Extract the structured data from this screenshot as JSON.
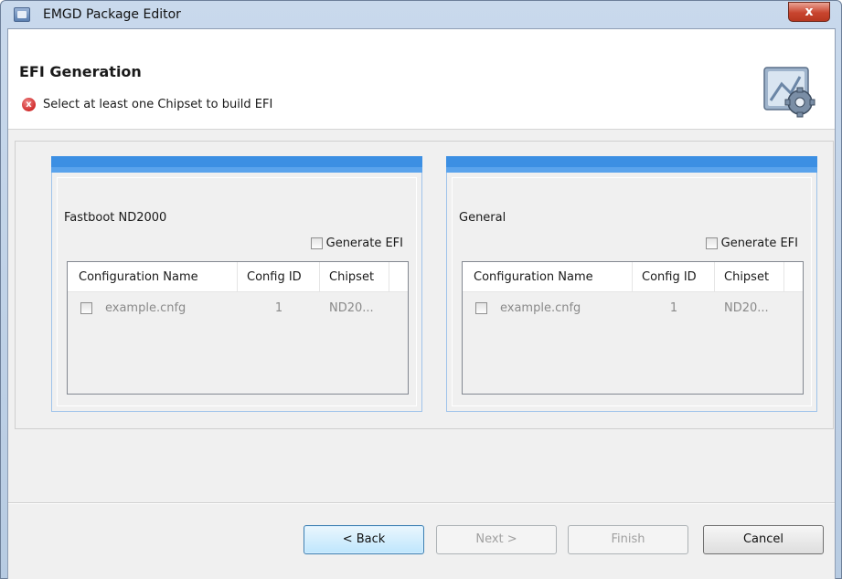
{
  "window": {
    "title": "EMGD Package Editor",
    "close_label": "x"
  },
  "header": {
    "title": "EFI Generation",
    "error_icon_glyph": "x",
    "message": "Select at least one Chipset to build EFI",
    "banner_icon": "gear-config-icon"
  },
  "groups": [
    {
      "title": "Fastboot ND2000",
      "generate_label": "Generate EFI",
      "columns": [
        "Configuration Name",
        "Config ID",
        "Chipset"
      ],
      "rows": [
        {
          "name": "example.cnfg",
          "id": "1",
          "chipset": "ND20..."
        }
      ]
    },
    {
      "title": "General",
      "generate_label": "Generate EFI",
      "columns": [
        "Configuration Name",
        "Config ID",
        "Chipset"
      ],
      "rows": [
        {
          "name": "example.cnfg",
          "id": "1",
          "chipset": "ND20..."
        }
      ]
    }
  ],
  "buttons": {
    "back": "< Back",
    "next": "Next >",
    "finish": "Finish",
    "cancel": "Cancel"
  },
  "colors": {
    "group_accent": "#3c8fe3",
    "error": "#d02b2b"
  }
}
